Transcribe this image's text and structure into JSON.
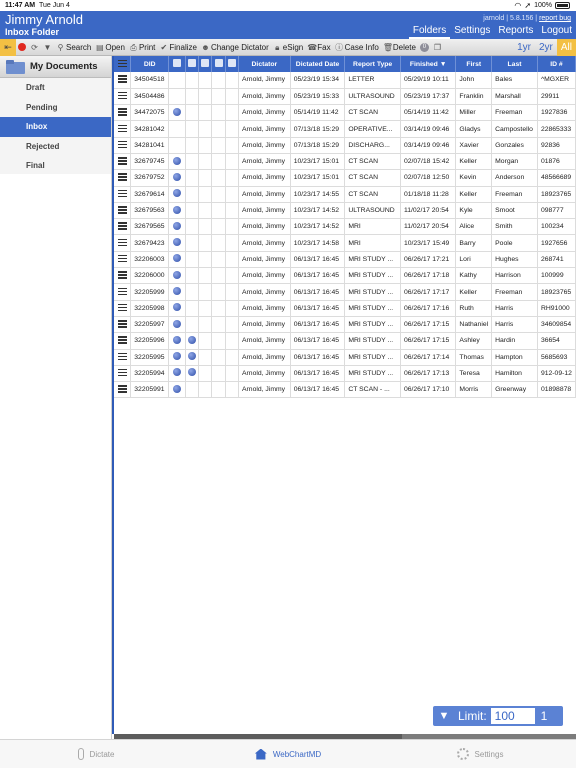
{
  "status": {
    "time": "11:47 AM",
    "date": "Tue Jun 4",
    "battery": "100%"
  },
  "header": {
    "user_name": "Jimmy Arnold",
    "folder_title": "Inbox Folder",
    "version": "jarnold | 5.8.156 |",
    "report_bug": "report bug",
    "nav": [
      "Folders",
      "Settings",
      "Reports",
      "Logout"
    ]
  },
  "toolbar": {
    "search": "Search",
    "open": "Open",
    "print": "Print",
    "finalize": "Finalize",
    "change_dictator": "Change Dictator",
    "esign": "eSign",
    "fax": "Fax",
    "case_info": "Case Info",
    "delete": "Delete",
    "badge": "0",
    "ranges": [
      "1yr",
      "2yr",
      "All"
    ]
  },
  "sidebar": {
    "title": "My Documents",
    "items": [
      "Draft",
      "Pending",
      "Inbox",
      "Rejected",
      "Final"
    ]
  },
  "table": {
    "headers": [
      "DID",
      "Dictator",
      "Dictated Date",
      "Report Type",
      "Finished ▼",
      "First",
      "Last",
      "ID #"
    ],
    "rows": [
      [
        "34504518",
        false,
        "Arnold, Jimmy",
        "05/23/19 15:34",
        "LETTER",
        "05/29/19 10:11",
        "John",
        "Bales",
        "^MGXER"
      ],
      [
        "34504486",
        false,
        "Arnold, Jimmy",
        "05/23/19 15:33",
        "ULTRASOUND",
        "05/23/19 17:37",
        "Franklin",
        "Marshall",
        "29911"
      ],
      [
        "34472075",
        true,
        "Arnold, Jimmy",
        "05/14/19 11:42",
        "CT SCAN",
        "05/14/19 11:42",
        "Miller",
        "Freeman",
        "1927836"
      ],
      [
        "34281042",
        false,
        "Arnold, Jimmy",
        "07/13/18 15:29",
        "OPERATIVE...",
        "03/14/19 09:46",
        "Gladys",
        "Campostello",
        "22865333"
      ],
      [
        "34281041",
        false,
        "Arnold, Jimmy",
        "07/13/18 15:29",
        "DISCHARG...",
        "03/14/19 09:46",
        "Xavier",
        "Gonzales",
        "92836"
      ],
      [
        "32679745",
        true,
        "Arnold, Jimmy",
        "10/23/17 15:01",
        "CT SCAN",
        "02/07/18 15:42",
        "Keller",
        "Morgan",
        "01876"
      ],
      [
        "32679752",
        true,
        "Arnold, Jimmy",
        "10/23/17 15:01",
        "CT SCAN",
        "02/07/18 12:50",
        "Kevin",
        "Anderson",
        "48566689"
      ],
      [
        "32679614",
        true,
        "Arnold, Jimmy",
        "10/23/17 14:55",
        "CT SCAN",
        "01/18/18 11:28",
        "Keller",
        "Freeman",
        "18923765"
      ],
      [
        "32679563",
        true,
        "Arnold, Jimmy",
        "10/23/17 14:52",
        "ULTRASOUND",
        "11/02/17 20:54",
        "Kyle",
        "Smoot",
        "098777"
      ],
      [
        "32679565",
        true,
        "Arnold, Jimmy",
        "10/23/17 14:52",
        "MRI",
        "11/02/17 20:54",
        "Alice",
        "Smith",
        "100234"
      ],
      [
        "32679423",
        true,
        "Arnold, Jimmy",
        "10/23/17 14:58",
        "MRI",
        "10/23/17 15:49",
        "Barry",
        "Poole",
        "1927656"
      ],
      [
        "32206003",
        true,
        "Arnold, Jimmy",
        "06/13/17 16:45",
        "MRI STUDY ...",
        "06/26/17 17:21",
        "Lori",
        "Hughes",
        "268741"
      ],
      [
        "32206000",
        true,
        "Arnold, Jimmy",
        "06/13/17 16:45",
        "MRI STUDY ...",
        "06/26/17 17:18",
        "Kathy",
        "Harrison",
        "100999"
      ],
      [
        "32205999",
        true,
        "Arnold, Jimmy",
        "06/13/17 16:45",
        "MRI STUDY ...",
        "06/26/17 17:17",
        "Keller",
        "Freeman",
        "18923765"
      ],
      [
        "32205998",
        true,
        "Arnold, Jimmy",
        "06/13/17 16:45",
        "MRI STUDY ...",
        "06/26/17 17:16",
        "Ruth",
        "Harris",
        "RH91000"
      ],
      [
        "32205997",
        true,
        "Arnold, Jimmy",
        "06/13/17 16:45",
        "MRI STUDY ...",
        "06/26/17 17:15",
        "Nathaniel",
        "Harris",
        "34609854"
      ],
      [
        "32205996",
        true,
        "Arnold, Jimmy",
        "06/13/17 16:45",
        "MRI STUDY ...",
        "06/26/17 17:15",
        "Ashley",
        "Hardin",
        "36654"
      ],
      [
        "32205995",
        true,
        "Arnold, Jimmy",
        "06/13/17 16:45",
        "MRI STUDY ...",
        "06/26/17 17:14",
        "Thomas",
        "Hampton",
        "5685693"
      ],
      [
        "32205994",
        true,
        "Arnold, Jimmy",
        "06/13/17 16:45",
        "MRI STUDY ...",
        "06/26/17 17:13",
        "Teresa",
        "Hamilton",
        "912-09-12"
      ],
      [
        "32205991",
        true,
        "Arnold, Jimmy",
        "06/13/17 16:45",
        "CT SCAN - ...",
        "06/26/17 17:10",
        "Morris",
        "Greenway",
        "01898878"
      ]
    ],
    "double_icon_rows": [
      16,
      17,
      18
    ]
  },
  "limit": {
    "label": "Limit:",
    "value": "100",
    "page": "1"
  },
  "tabbar": [
    "Dictate",
    "WebChartMD",
    "Settings"
  ]
}
